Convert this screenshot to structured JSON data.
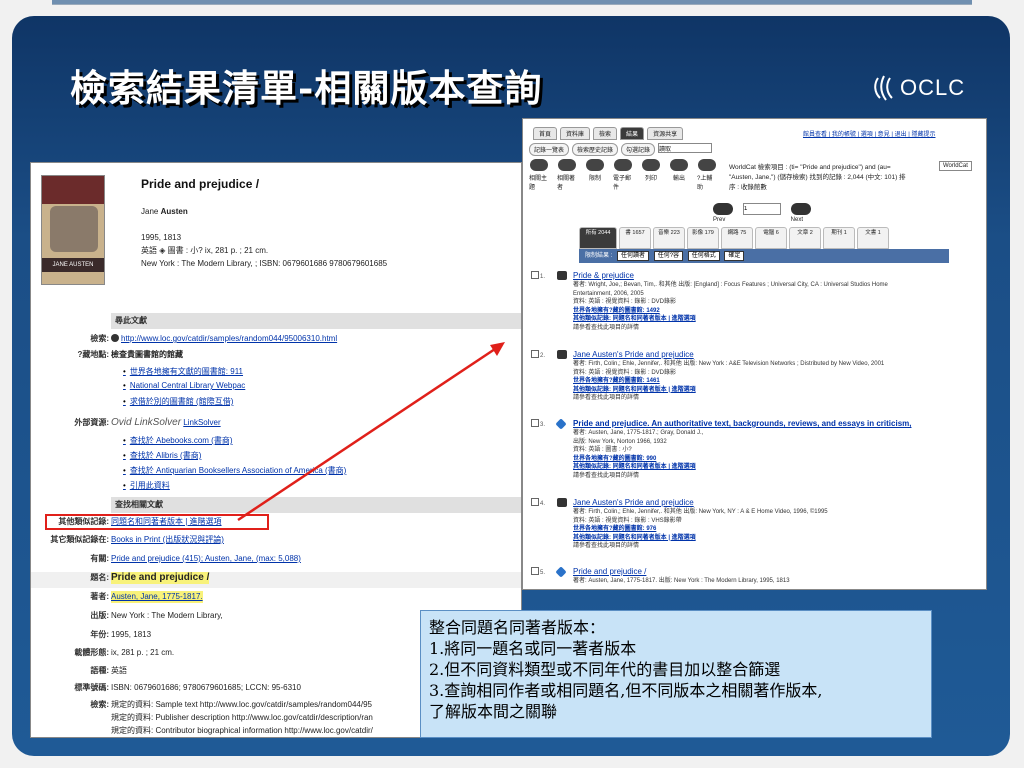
{
  "slide": {
    "title": "檢索結果清單-相關版本查詢",
    "logo_text": "OCLC"
  },
  "detail": {
    "cover_series": "PRIDE AND PREJUDICE",
    "cover_author": "JANE AUSTEN",
    "title": "Pride and prejudice /",
    "author_prefix": "Jane",
    "author_last": "Austen",
    "year_line": "1995, 1813",
    "lang_line": "英語 ◈ 圖書 : 小? ix, 281 p. ; 21 cm.",
    "pub_line": "New York : The Modern Library, ; ISBN: 0679601686 9780679601685",
    "sections": {
      "find": "尋此文獻",
      "related": "查找相關文獻"
    },
    "labels": {
      "search": "檢索:",
      "where": "?藏地點:",
      "external": "外部資源:",
      "other_records": "其他類似記錄:",
      "other_records_in": "其它類似記錄在:",
      "has": "有關:",
      "title": "題名:",
      "author": "著者:",
      "publish": "出版:",
      "year": "年份:",
      "physical": "載體形態:",
      "language": "語種:",
      "standard_no": "標準號碼:",
      "search2": "檢索:"
    },
    "values": {
      "search_link": "http://www.loc.gov/catdir/samples/random044/95006310.html",
      "where_head": "檢查貴圖書館的館藏",
      "where_items": [
        "世界各地擁有文獻的圖書館: 911",
        "National Central Library Webpac",
        "求借於別的圖書館 (館際互借)"
      ],
      "ovid": "Ovid LinkSolver",
      "linksolver": "LinkSolver",
      "ext_items": [
        "查找於 Abebooks.com (書商)",
        "查找於 Alibris (書商)",
        "查找於 Antiquarian Booksellers Association of America (書商)",
        "引用此資料"
      ],
      "other_records_links": "同題名和同著者版本 | 進階選項",
      "other_records_in": "Books in Print (出版狀況與評論)",
      "has_value": "Pride and prejudice (415); Austen, Jane, (max: 5,088)",
      "title_value": "Pride and prejudice /",
      "author_value": "Austen, Jane, 1775-1817.",
      "publish_value": "New York : The Modern Library,",
      "year_value": "1995, 1813",
      "physical_value": "ix, 281 p. ; 21 cm.",
      "language_value": "英語",
      "standard_value": "ISBN: 0679601686; 9780679601685; LCCN: 95-6310",
      "search2_items": [
        "規定的資料: Sample text http://www.loc.gov/catdir/samples/random044/95",
        "規定的資料: Publisher description http://www.loc.gov/catdir/description/ran",
        "規定的資料: Contributor biographical information http://www.loc.gov/catdir/"
      ]
    }
  },
  "results_page": {
    "tabs": [
      "首頁",
      "資料庫",
      "檢索",
      "結果",
      "資源共享"
    ],
    "active_tab": "結果",
    "top_links": "館員查看 | 我的帳號 | 選項 | 意見 | 退出 | 隱藏提示",
    "subtabs": [
      "記錄一覽表",
      "檢索歷史記錄",
      "勾選記錄"
    ],
    "subtab_select": "讀取",
    "tools": [
      "相關主題",
      "相關著者",
      "限制",
      "電子郵件",
      "列印",
      "輸出",
      "?上輔助"
    ],
    "summary": "WorldCat 檢索項目 : (ti= \"Pride and prejudice\") and (au= \"Austen, Jane,\") (儲存檢索) 找到的記錄 : 2,044 (中文: 101) 排序 : 收錄館數",
    "worldcat_label": "WorldCat",
    "pager_value": "1",
    "pager_prev": "Prev",
    "pager_next": "Next",
    "format_tabs": [
      "所有 2044",
      "書 1657",
      "音樂 223",
      "影像 179",
      "網路 75",
      "電腦 6",
      "文章 2",
      "期刊 1",
      "文書 1"
    ],
    "limit_label": "限制結果 :",
    "limit_selects": [
      "任何讀者",
      "任何?容",
      "任何格式"
    ],
    "limit_go": "確定",
    "results": [
      {
        "num": "1.",
        "title": "Pride & prejudice",
        "lines": [
          "著者: Wright, Joe,; Bevan, Tim,. 和其他 出版: [England] : Focus Features ; Universal City, CA : Universal Studios Home",
          "Entertainment, 2006, 2005",
          "資料: 英語 : 視覺資料 : 錄影 : DVD錄影",
          "世界各地擁有?藏的圖書館: 1492",
          "其他類似記錄: 同題名和同著者版本 | 進階選項",
          "請參看查找此項目的詳情"
        ]
      },
      {
        "num": "2.",
        "title": "Jane Austen's Pride and prejudice",
        "lines": [
          "著者: Firth, Colin,; Ehle, Jennifer,. 和其他 出版: New York : A&E Television Networks ; Distributed by New Video, 2001",
          "資料: 英語 : 視覺資料 : 錄影 : DVD錄影",
          "世界各地擁有?藏的圖書館: 1461",
          "其他類似記錄: 同題名和同著者版本 | 進階選項",
          "請參看查找此項目的詳情"
        ]
      },
      {
        "num": "3.",
        "title": "Pride and prejudice. An authoritative text, backgrounds, reviews, and essays in criticism,",
        "lines": [
          "著者: Austen, Jane, 1775-1817.; Gray, Donald J.,",
          "出版: New York, Norton 1966, 1932",
          "資料: 英語 : 圖書 : 小?",
          "世界各地擁有?藏的圖書館: 990",
          "其他類似記錄: 同題名和同著者版本 | 進階選項",
          "請參看查找此項目的詳情"
        ]
      },
      {
        "num": "4.",
        "title": "Jane Austen's Pride and prejudice",
        "lines": [
          "著者: Firth, Colin,; Ehle, Jennifer,. 和其他 出版: New York, NY : A & E Home Video, 1996, ©1995",
          "資料: 英語 : 視覺資料 : 錄影 : VHS錄影帶",
          "世界各地擁有?藏的圖書館: 976",
          "其他類似記錄: 同題名和同著者版本 | 進階選項",
          "請參看查找此項目的詳情"
        ]
      },
      {
        "num": "5.",
        "title": "Pride and prejudice /",
        "lines": [
          "著者: Austen, Jane, 1775-1817. 出版: New York : The Modern Library, 1995, 1813"
        ]
      }
    ]
  },
  "callout": {
    "lines": [
      "整合同題名同著者版本：",
      "1.將同一題名或同一著者版本",
      "2.但不同資料類型或不同年代的書目加以整合篩選",
      "3.查詢相同作者或相同題名,但不同版本之相關著作版本,",
      "了解版本間之關聯"
    ]
  },
  "colors": {
    "banner": "#1b4e86",
    "arrow": "#e0201a",
    "callout_bg": "#c8e3f7",
    "link": "#0033aa"
  }
}
